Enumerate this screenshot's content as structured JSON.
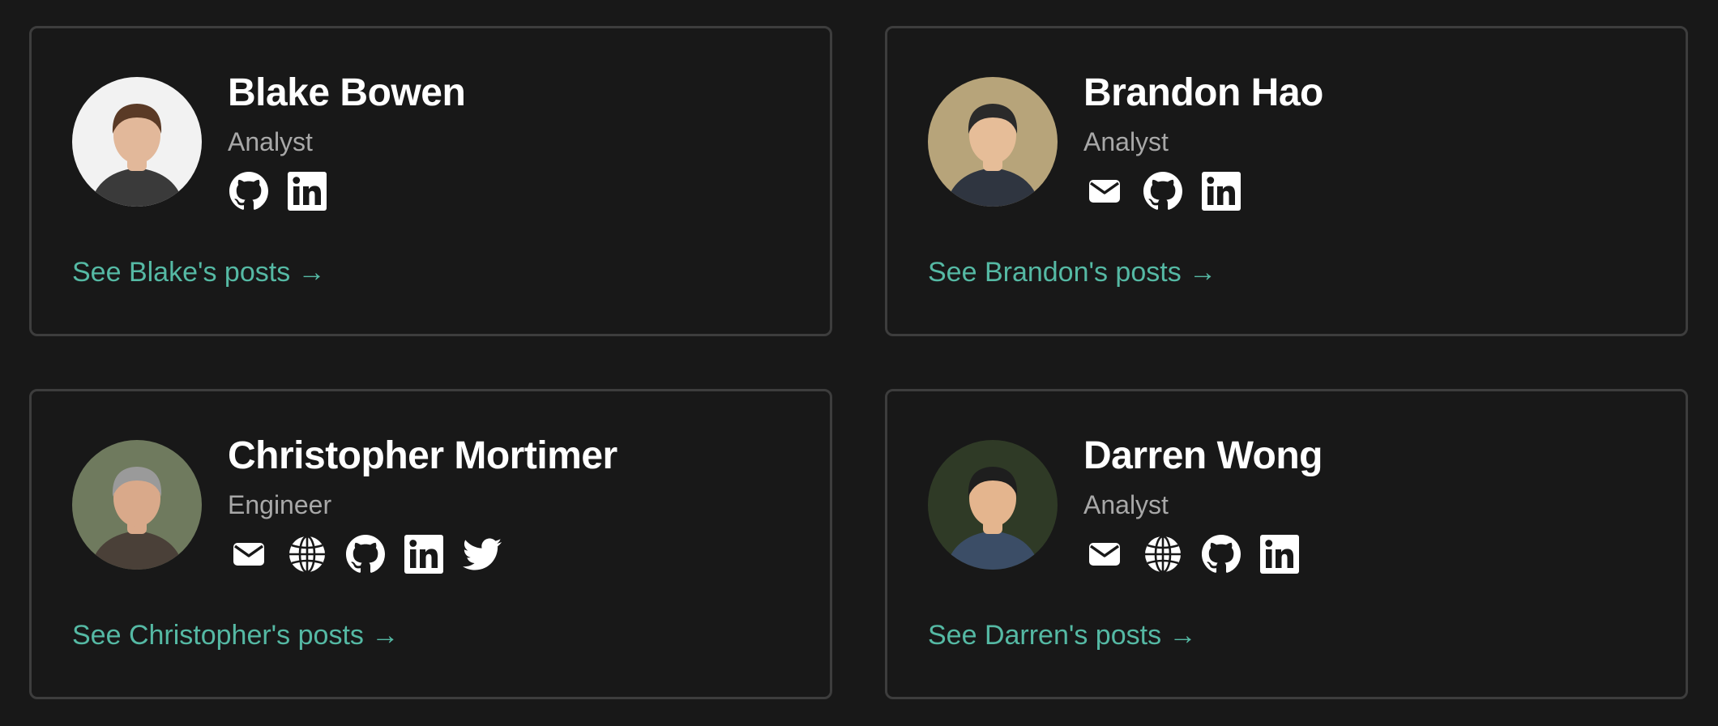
{
  "members": [
    {
      "name": "Blake Bowen",
      "role": "Analyst",
      "posts_link": "See Blake's posts →",
      "avatar": {
        "bg": "#f2f2f2",
        "skin": "#e2b89a",
        "hair": "#5a3a26",
        "shirt": "#3a3a3a"
      },
      "socials": [
        "github-icon",
        "linkedin-icon"
      ]
    },
    {
      "name": "Brandon Hao",
      "role": "Analyst",
      "posts_link": "See Brandon's posts →",
      "avatar": {
        "bg": "#b7a47a",
        "skin": "#e6bd98",
        "hair": "#2a2a2a",
        "shirt": "#2f3540"
      },
      "socials": [
        "email-icon",
        "github-icon",
        "linkedin-icon"
      ]
    },
    {
      "name": "Christopher Mortimer",
      "role": "Engineer",
      "posts_link": "See Christopher's posts →",
      "avatar": {
        "bg": "#6f7a5e",
        "skin": "#d9a98a",
        "hair": "#9a9a9a",
        "shirt": "#4a4038"
      },
      "socials": [
        "email-icon",
        "globe-icon",
        "github-icon",
        "linkedin-icon",
        "twitter-icon"
      ]
    },
    {
      "name": "Darren Wong",
      "role": "Analyst",
      "posts_link": "See Darren's posts →",
      "avatar": {
        "bg": "#2f3a26",
        "skin": "#e4b58e",
        "hair": "#1e1e1e",
        "shirt": "#3b4d66"
      },
      "socials": [
        "email-icon",
        "globe-icon",
        "github-icon",
        "linkedin-icon"
      ]
    }
  ],
  "colors": {
    "background": "#181818",
    "card_border": "#3d3d3d",
    "name": "#ffffff",
    "role": "#a8a8a8",
    "link": "#55b9a4",
    "icon": "#ffffff"
  }
}
